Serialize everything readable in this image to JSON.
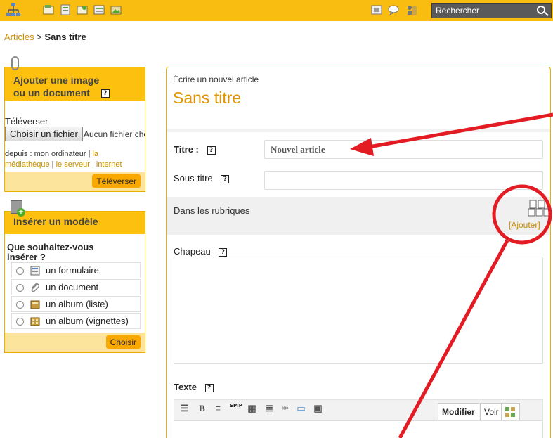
{
  "search": {
    "placeholder": "Rechercher"
  },
  "icons": {
    "home": "site-map-icon",
    "toolbar": [
      "articles-icon",
      "sections-icon",
      "authors-icon",
      "forums-icon",
      "media-icon"
    ],
    "right": [
      "preview-icon",
      "messages-icon",
      "users-icon"
    ]
  },
  "breadcrumb": {
    "parent": "Articles",
    "separator": ">",
    "current": "Sans titre"
  },
  "upload_box": {
    "title_line1": "Ajouter une image",
    "title_line2": "ou un document",
    "help": "?",
    "upload_label": "Téléverser",
    "file_button": "Choisir un fichier",
    "file_status": "Aucun fichier choisi",
    "from_prefix": "depuis : mon ordinateur |",
    "link_library": "la médiathèque",
    "link_server": "le serveur",
    "link_internet": "internet",
    "submit": "Téléverser"
  },
  "template_box": {
    "title": "Insérer un modèle",
    "question_line1": "Que souhaitez-vous",
    "question_line2": "insérer ?",
    "options": [
      {
        "label": "un formulaire",
        "icon": "form-icon"
      },
      {
        "label": "un document",
        "icon": "paperclip-icon"
      },
      {
        "label": "un album (liste)",
        "icon": "album-list-icon"
      },
      {
        "label": "un album (vignettes)",
        "icon": "album-thumbnails-icon"
      }
    ],
    "submit": "Choisir"
  },
  "editor": {
    "subtitle": "Écrire un nouvel article",
    "title": "Sans titre",
    "titre_label": "Titre :",
    "titre_placeholder": "Nouvel article",
    "soustitre_label": "Sous-titre",
    "rubriques_label": "Dans les rubriques",
    "add_label": "[Ajouter]",
    "chapeau_label": "Chapeau",
    "texte_label": "Texte",
    "tab_modifier": "Modifier",
    "tab_voir": "Voir",
    "toolbar_bold": "B",
    "toolbar_spip": "SPIP",
    "toolbar_quote": "«»"
  },
  "annotation_color": "#e31b23"
}
